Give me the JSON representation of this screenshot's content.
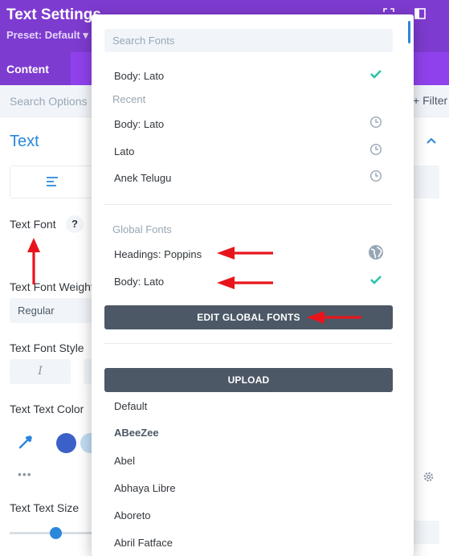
{
  "header": {
    "title": "Text Settings",
    "preset": "Preset: Default ▾"
  },
  "tabs": {
    "active_label": "Content"
  },
  "search_bar": {
    "placeholder": "Search Options",
    "filter_label": "+ Filter"
  },
  "group": {
    "title": "Text"
  },
  "fields": {
    "text_font_label": "Text Font",
    "help_glyph": "?",
    "font_weight_label": "Text Font Weight",
    "font_weight_value": "Regular",
    "font_style_label": "Text Font Style",
    "italic_glyph": "I",
    "text_color_label": "Text Text Color",
    "more_dots": "•••",
    "text_size_label": "Text Text Size"
  },
  "colors": {
    "header_purple": "#7e3bd0",
    "tab_purple": "#8f42ec",
    "accent_blue": "#2b87da",
    "check_green": "#29c4a9",
    "button_dark": "#4c5866",
    "swatch_blue": "#3b61c8",
    "swatch_light": "#c2dcf4",
    "annotation_red": "#e8141c"
  },
  "font_dropdown": {
    "search_placeholder": "Search Fonts",
    "selected_font": "Body: Lato",
    "recent_heading": "Recent",
    "recent": [
      "Body: Lato",
      "Lato",
      "Anek Telugu"
    ],
    "global_heading": "Global Fonts",
    "global": [
      "Headings: Poppins",
      "Body: Lato"
    ],
    "edit_global_label": "EDIT GLOBAL FONTS",
    "upload_label": "UPLOAD",
    "fonts": [
      "Default",
      "ABeeZee",
      "Abel",
      "Abhaya Libre",
      "Aboreto",
      "Abril Fatface"
    ]
  },
  "icons": {
    "selected": "check-icon",
    "recent": "clock-icon",
    "global_headings": "globe-icon",
    "global_body": "check-icon"
  }
}
